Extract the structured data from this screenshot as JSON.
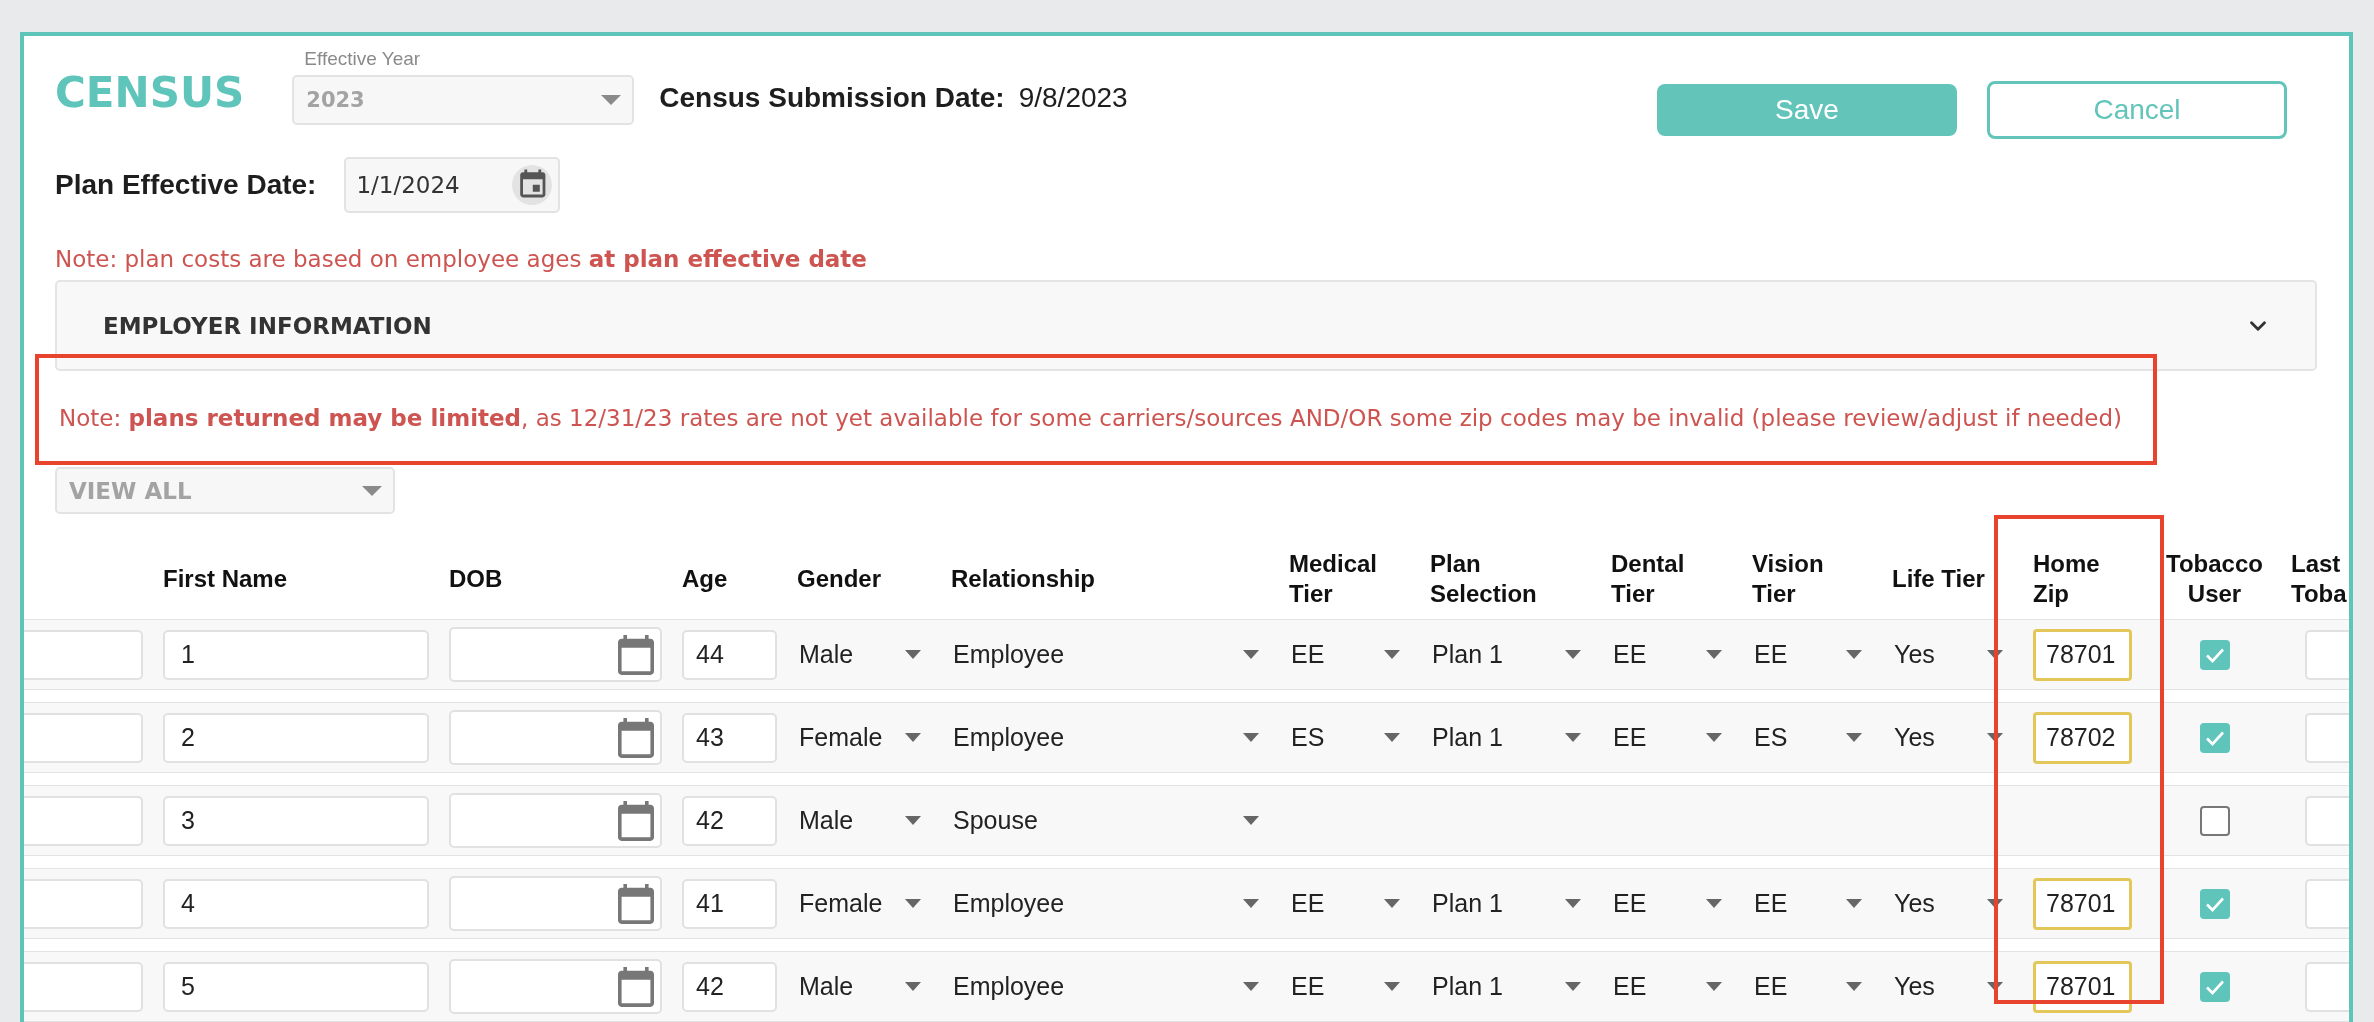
{
  "header": {
    "title": "CENSUS",
    "effective_year": {
      "label": "Effective Year",
      "value": "2023",
      "disabled": true
    },
    "submission_date": {
      "label": "Census Submission Date:",
      "value": "9/8/2023"
    },
    "buttons": [
      {
        "label": "Save",
        "kind": "primary"
      },
      {
        "label": "Cancel",
        "kind": "secondary"
      }
    ]
  },
  "plan_effective_date": {
    "label": "Plan Effective Date:",
    "value": "1/1/2024"
  },
  "age_note": {
    "text": "Note: plan costs are based on employee ages **at plan effective date**",
    "highlighted": false
  },
  "employer_panel": {
    "title": "EMPLOYER INFORMATION",
    "expanded": false
  },
  "limits_note": {
    "text": "Note: **plans returned may be limited**, as 12/31/23 rates are not yet available for some carriers/sources AND/OR some zip codes may be invalid (please review/adjust if needed)",
    "highlighted": true
  },
  "filter": {
    "value": "VIEW ALL",
    "disabled": true
  },
  "table": {
    "columns": [
      {
        "label": "First Name",
        "highlighted": false
      },
      {
        "label": "DOB",
        "highlighted": false
      },
      {
        "label": "Age",
        "highlighted": false
      },
      {
        "label": "Gender",
        "highlighted": false
      },
      {
        "label": "Relationship",
        "highlighted": false
      },
      {
        "label": "Medical Tier",
        "highlighted": false
      },
      {
        "label": "Plan Selection",
        "highlighted": false
      },
      {
        "label": "Dental Tier",
        "highlighted": false
      },
      {
        "label": "Vision Tier",
        "highlighted": false
      },
      {
        "label": "Life Tier",
        "highlighted": false
      },
      {
        "label": "Home Zip",
        "highlighted": true
      },
      {
        "label": "Tobacco User",
        "highlighted": false
      },
      {
        "label": "Last Toba",
        "highlighted": false
      }
    ],
    "rows": [
      {
        "first_name": "1",
        "age": "44",
        "gender": "Male",
        "relationship": "Employee",
        "medical_tier": "EE",
        "plan_selection": "Plan 1",
        "dental_tier": "EE",
        "vision_tier": "EE",
        "life_tier": "Yes",
        "home_zip": "78701",
        "zip_warning": true,
        "tobacco_user": true
      },
      {
        "first_name": "2",
        "age": "43",
        "gender": "Female",
        "relationship": "Employee",
        "medical_tier": "ES",
        "plan_selection": "Plan 1",
        "dental_tier": "EE",
        "vision_tier": "ES",
        "life_tier": "Yes",
        "home_zip": "78702",
        "zip_warning": true,
        "tobacco_user": true
      },
      {
        "first_name": "3",
        "age": "42",
        "gender": "Male",
        "relationship": "Spouse",
        "tobacco_user": false
      },
      {
        "first_name": "4",
        "age": "41",
        "gender": "Female",
        "relationship": "Employee",
        "medical_tier": "EE",
        "plan_selection": "Plan 1",
        "dental_tier": "EE",
        "vision_tier": "EE",
        "life_tier": "Yes",
        "home_zip": "78701",
        "zip_warning": true,
        "tobacco_user": true
      },
      {
        "first_name": "5",
        "age": "42",
        "gender": "Male",
        "relationship": "Employee",
        "medical_tier": "EE",
        "plan_selection": "Plan 1",
        "dental_tier": "EE",
        "vision_tier": "EE",
        "life_tier": "Yes",
        "home_zip": "78701",
        "zip_warning": true,
        "tobacco_user": true
      }
    ]
  }
}
